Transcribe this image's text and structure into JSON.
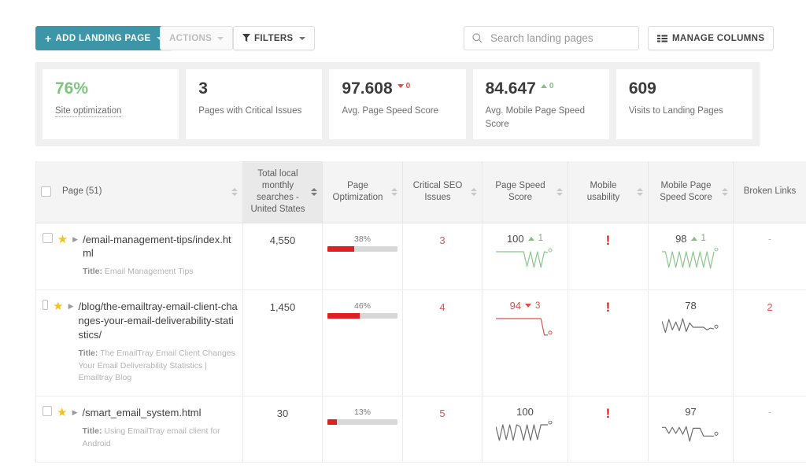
{
  "toolbar": {
    "add_label": "ADD LANDING PAGE",
    "add_plus": "+",
    "actions_label": "ACTIONS",
    "filters_label": "FILTERS",
    "manage_columns_label": "MANAGE COLUMNS",
    "search_placeholder": "Search landing pages",
    "search_value": ""
  },
  "kpis": [
    {
      "value": "76%",
      "label": "Site optimization",
      "value_color": "#7ec37e",
      "underline": true,
      "delta": null,
      "delta_dir": null
    },
    {
      "value": "3",
      "label": "Pages with Critical Issues",
      "value_color": "#3b3b3b",
      "underline": false,
      "delta": null,
      "delta_dir": null
    },
    {
      "value": "97.608",
      "label": "Avg. Page Speed Score",
      "value_color": "#3b3b3b",
      "underline": false,
      "delta": "0",
      "delta_dir": "down"
    },
    {
      "value": "84.647",
      "label": "Avg. Mobile Page Speed Score",
      "value_color": "#3b3b3b",
      "underline": false,
      "delta": "0",
      "delta_dir": "up"
    },
    {
      "value": "609",
      "label": "Visits to Landing Pages",
      "value_color": "#3b3b3b",
      "underline": false,
      "delta": null,
      "delta_dir": null
    }
  ],
  "table": {
    "columns": [
      {
        "label": "Page (51)",
        "sorted": false
      },
      {
        "label": "Total local monthly searches - United States",
        "sorted": true
      },
      {
        "label": "Page Optimization",
        "sorted": false
      },
      {
        "label": "Critical SEO Issues",
        "sorted": false
      },
      {
        "label": "Page Speed Score",
        "sorted": false
      },
      {
        "label": "Mobile usability",
        "sorted": false
      },
      {
        "label": "Mobile Page Speed Score",
        "sorted": false
      },
      {
        "label": "Broken Links",
        "sorted": false
      }
    ],
    "title_prefix": "Title:",
    "rows": [
      {
        "url": "/email-management-tips/index.html",
        "title": "Email Management Tips",
        "searches": "4,550",
        "optimization_pct": "38%",
        "optimization_value": 38,
        "critical_issues": "3",
        "page_speed": "100",
        "page_speed_delta": "1",
        "page_speed_dir": "up",
        "mobile_usability": "!",
        "mobile_speed": "98",
        "mobile_speed_delta": "1",
        "mobile_speed_dir": "up",
        "broken_links": "-"
      },
      {
        "url": "/blog/the-emailtray-email-client-changes-your-email-deliverability-statistics/",
        "title": "The EmailTray Email Client Changes Your Email Deliverability Statistics | Emailtray Blog",
        "searches": "1,450",
        "optimization_pct": "46%",
        "optimization_value": 46,
        "critical_issues": "4",
        "page_speed": "94",
        "page_speed_delta": "3",
        "page_speed_dir": "down",
        "mobile_usability": "!",
        "mobile_speed": "78",
        "mobile_speed_delta": null,
        "mobile_speed_dir": null,
        "broken_links": "2"
      },
      {
        "url": "/smart_email_system.html",
        "title": "Using EmailTray email client for Android",
        "searches": "30",
        "optimization_pct": "13%",
        "optimization_value": 13,
        "critical_issues": "5",
        "page_speed": "100",
        "page_speed_delta": null,
        "page_speed_dir": null,
        "mobile_usability": "!",
        "mobile_speed": "97",
        "mobile_speed_delta": null,
        "mobile_speed_dir": null,
        "broken_links": "-"
      }
    ]
  },
  "colors": {
    "accent": "#3c96a8",
    "good": "#7ec37e",
    "bad": "#e02020",
    "bar_track": "#d8d8d8",
    "star": "#f5c21b"
  }
}
